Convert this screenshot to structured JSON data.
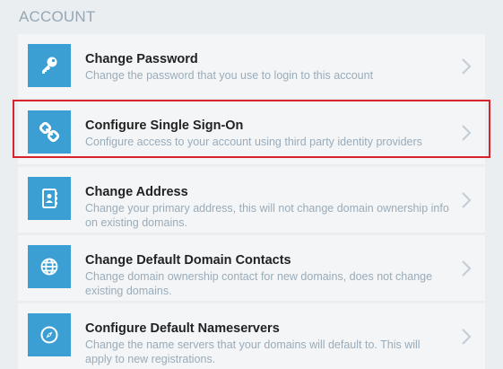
{
  "section": {
    "title": "ACCOUNT"
  },
  "items": [
    {
      "title": "Change Password",
      "desc": "Change the password that you use to login to this account",
      "icon": "key-icon"
    },
    {
      "title": "Configure Single Sign-On",
      "desc": "Configure access to your account using third party identity providers",
      "icon": "link-icon"
    },
    {
      "title": "Change Address",
      "desc": "Change your primary address, this will not change domain ownership info on existing domains.",
      "icon": "address-book-icon"
    },
    {
      "title": "Change Default Domain Contacts",
      "desc": "Change domain ownership contact for new domains, does not change existing domains.",
      "icon": "globe-icon"
    },
    {
      "title": "Configure Default Nameservers",
      "desc": "Change the name servers that your domains will default to. This will apply to new registrations.",
      "icon": "compass-icon"
    }
  ],
  "colors": {
    "accent": "#3b9fd3",
    "highlight": "#d9232a",
    "background": "#eaeef1"
  }
}
